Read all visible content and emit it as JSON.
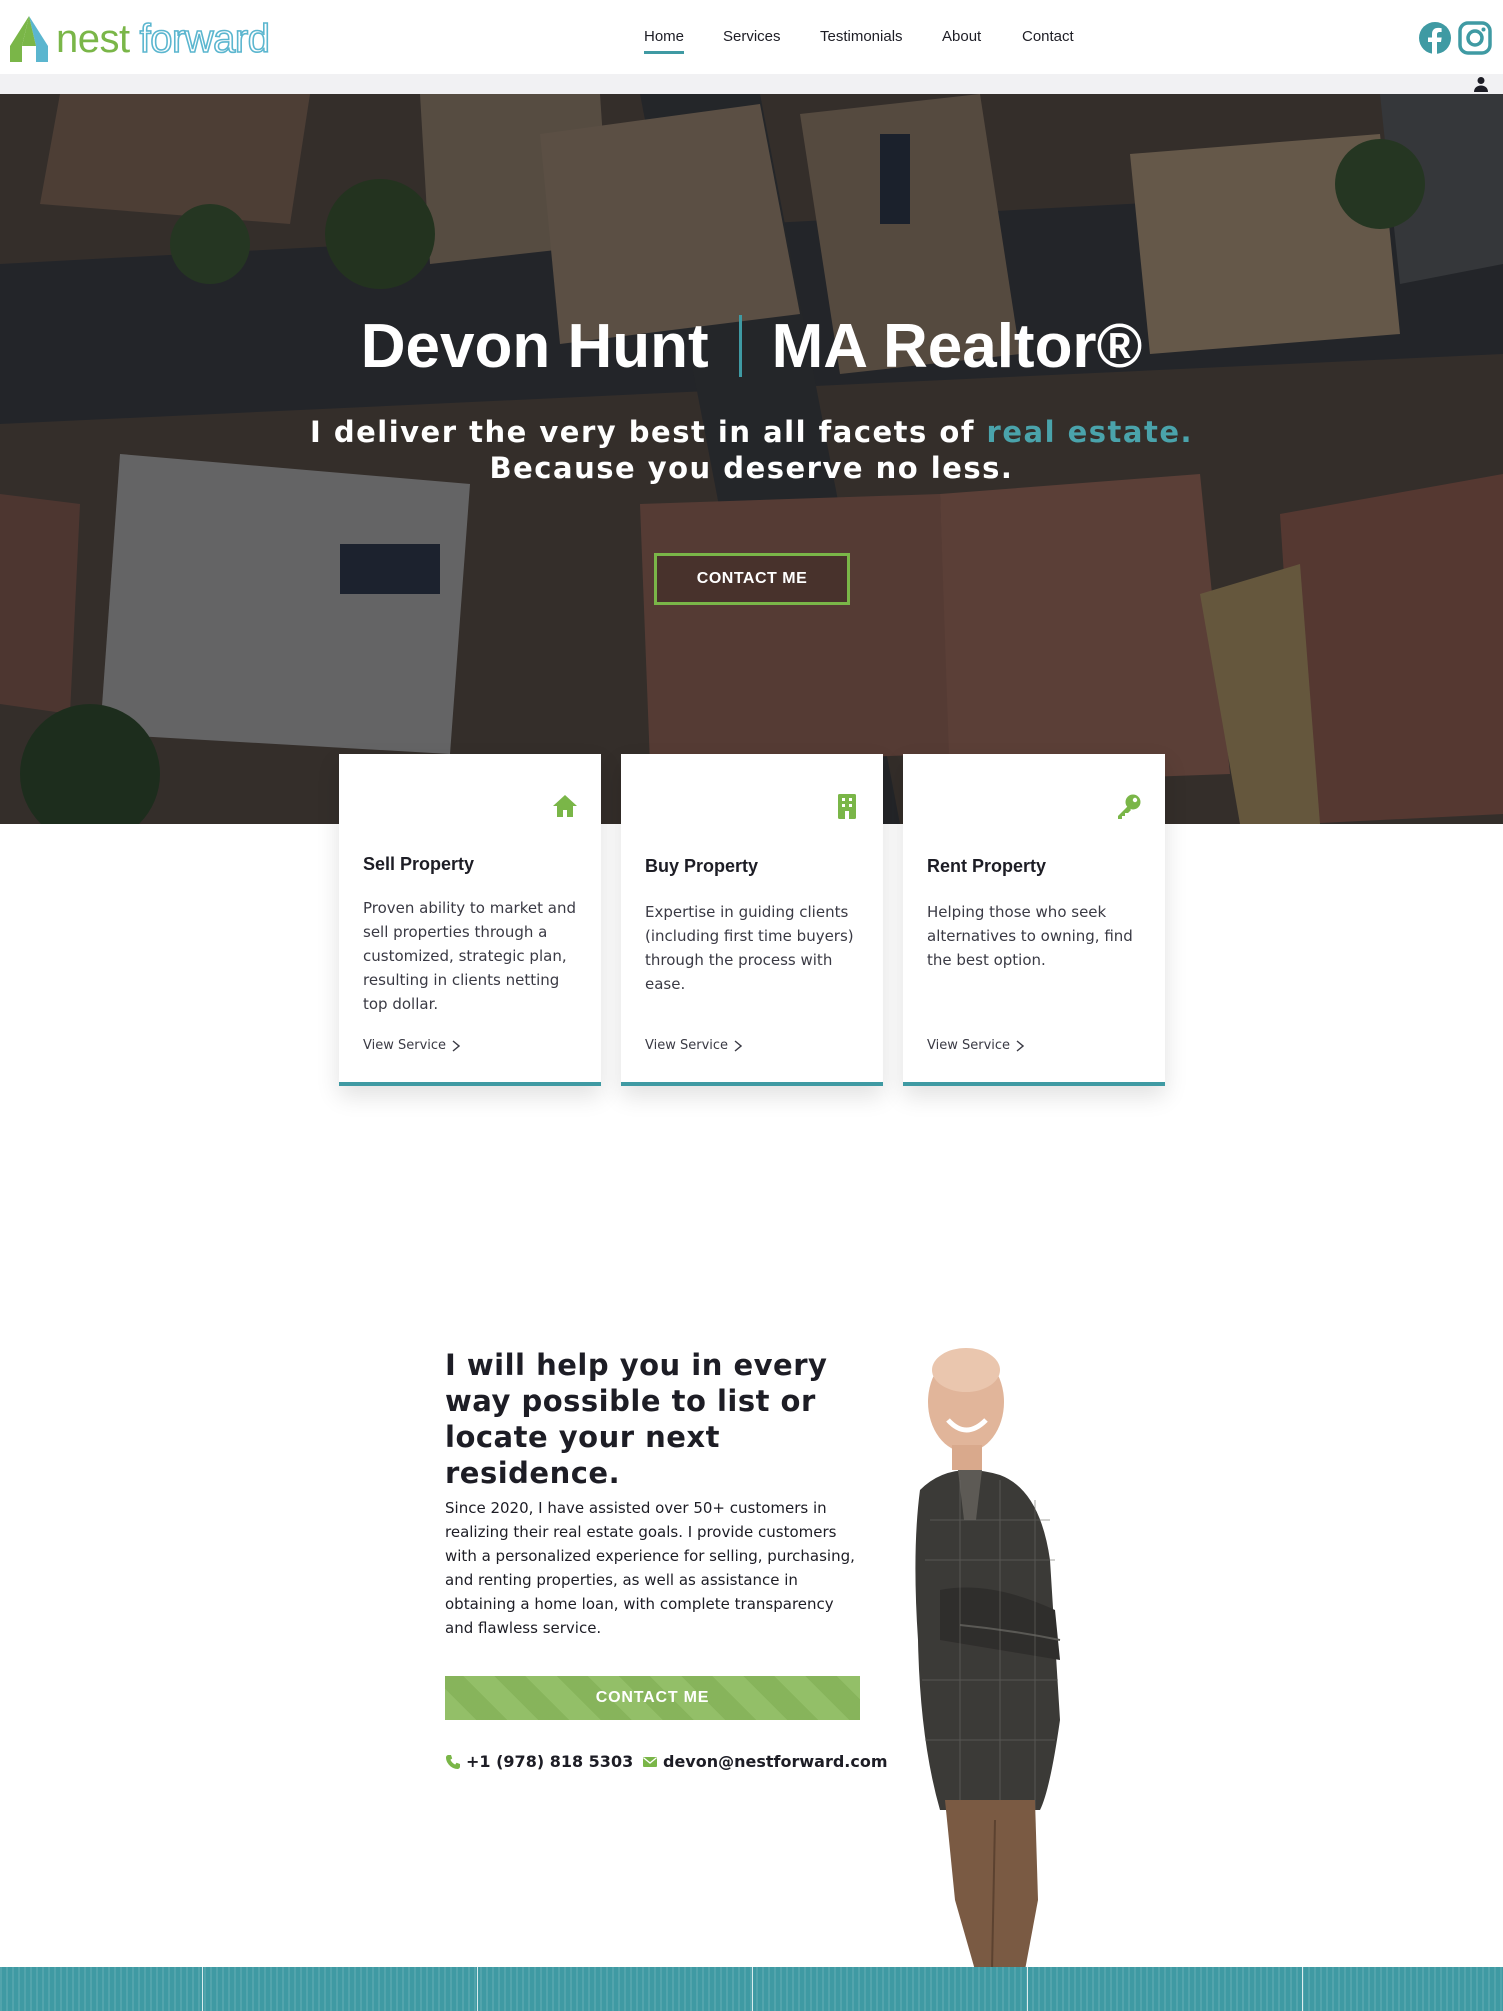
{
  "brand": {
    "name_part1": "nest",
    "name_part2": "forward",
    "green": "#7ab648",
    "blue": "#5bb6cf",
    "teal": "#3f9aa3"
  },
  "nav": {
    "items": [
      "Home",
      "Services",
      "Testimonials",
      "About",
      "Contact"
    ],
    "active": "Home"
  },
  "social": {
    "icons": [
      "facebook-icon",
      "instagram-icon"
    ]
  },
  "topbar": {
    "icon": "user-icon"
  },
  "hero": {
    "name": "Devon Hunt",
    "role": "MA Realtor®",
    "tagline_part1": "I deliver the very best in all facets of ",
    "tagline_accent": "real estate.",
    "tagline_line2": "Because you deserve no less.",
    "cta_label": "CONTACT ME"
  },
  "services": [
    {
      "icon": "house-icon",
      "title": "Sell Property",
      "text": "Proven ability to market and sell properties through a customized, strategic plan, resulting in clients netting top dollar.",
      "link": "View Service"
    },
    {
      "icon": "building-icon",
      "title": "Buy Property",
      "text": "Expertise in guiding clients (including first time buyers) through the process with ease.",
      "link": "View Service"
    },
    {
      "icon": "key-icon",
      "title": "Rent Property",
      "text": "Helping those who seek alternatives to owning, find the best option.",
      "link": "View Service"
    }
  ],
  "about": {
    "heading": "I will help you in every way possible to list or locate your next residence.",
    "body": "Since 2020, I have assisted over 50+ customers in realizing their real estate goals. I provide customers with a personalized experience for selling, purchasing, and renting properties, as well as assistance in obtaining a home loan, with complete transparency and flawless service.",
    "cta_label": "CONTACT ME",
    "phone": "+1 (978) 818 5303",
    "email": "devon@nestforward.com"
  }
}
